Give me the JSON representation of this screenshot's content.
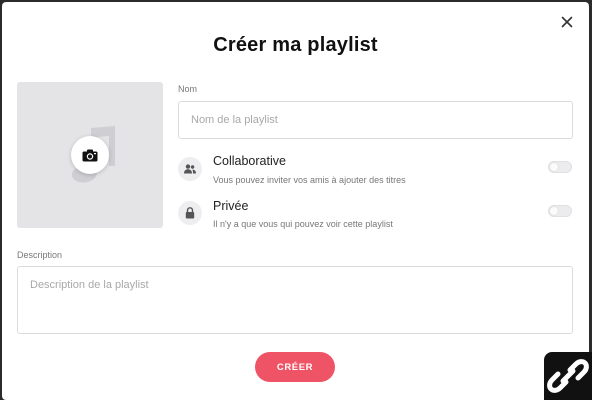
{
  "dialog": {
    "title": "Créer ma playlist",
    "close_icon": "close-icon"
  },
  "cover": {
    "placeholder_icon": "music-note-icon",
    "upload_icon": "camera-icon"
  },
  "name_field": {
    "label": "Nom",
    "placeholder": "Nom de la playlist",
    "value": ""
  },
  "options": [
    {
      "icon": "people-icon",
      "title": "Collaborative",
      "description": "Vous pouvez inviter vos amis à ajouter des titres",
      "enabled": false
    },
    {
      "icon": "lock-icon",
      "title": "Privée",
      "description": "Il n'y a que vous qui pouvez voir cette playlist",
      "enabled": false
    }
  ],
  "description_field": {
    "label": "Description",
    "placeholder": "Description de la playlist",
    "value": ""
  },
  "submit": {
    "label": "CRÉER"
  },
  "colors": {
    "accent": "#ef5466",
    "background": "#ffffff"
  }
}
